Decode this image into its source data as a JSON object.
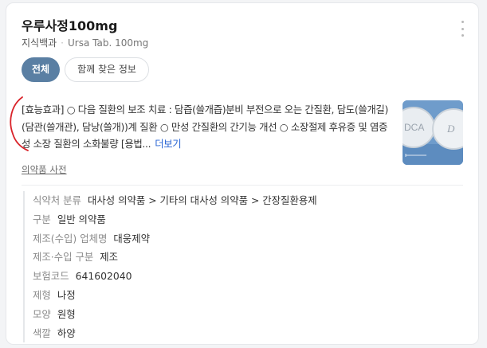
{
  "header": {
    "title": "우루사정100mg",
    "source": "지식백과",
    "english_name": "Ursa Tab. 100mg"
  },
  "tabs": [
    {
      "label": "전체",
      "active": true
    },
    {
      "label": "함께 찾은 정보",
      "active": false
    }
  ],
  "description": {
    "text": "[효능효과] ○ 다음 질환의 보조 치료 : 담즙(쓸개즙)분비 부전으로 오는 간질환, 담도(쓸개길)(담관(쓸개관), 담낭(쓸개))계 질환 ○ 만성 간질환의 간기능 개선 ○ 소장절제 후유증 및 염증성 소장 질환의 소화불량 [용법...",
    "more_label": "더보기"
  },
  "thumbnail": {
    "imprint_left": "DCA",
    "imprint_right": "D"
  },
  "dictionary_link": "의약품 사전",
  "info": [
    {
      "key": "식약처 분류",
      "value": "대사성 의약품 > 기타의 대사성 의약품 > 간장질환용제"
    },
    {
      "key": "구분",
      "value": "일반 의약품"
    },
    {
      "key": "제조(수입) 업체명",
      "value": "대웅제약"
    },
    {
      "key": "제조·수입 구분",
      "value": "제조"
    },
    {
      "key": "보험코드",
      "value": "641602040"
    },
    {
      "key": "제형",
      "value": "나정"
    },
    {
      "key": "모양",
      "value": "원형"
    },
    {
      "key": "색깔",
      "value": "하양"
    }
  ],
  "colors": {
    "active_tab": "#5a7fa3",
    "link": "#2965d4",
    "annotation": "#d9232a"
  }
}
